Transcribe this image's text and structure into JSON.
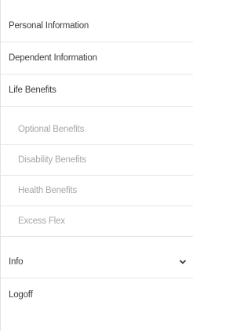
{
  "menu": {
    "items": [
      {
        "label": "Personal Information"
      },
      {
        "label": "Dependent Information"
      },
      {
        "label": "Life Benefits"
      }
    ],
    "sub_items": [
      {
        "label": "Optional Benefits"
      },
      {
        "label": "Disability Benefits"
      },
      {
        "label": "Health Benefits"
      },
      {
        "label": "Excess Flex"
      }
    ],
    "info": {
      "label": "Info",
      "icon": "chevron-down-icon"
    },
    "logoff": {
      "label": "Logoff"
    }
  }
}
